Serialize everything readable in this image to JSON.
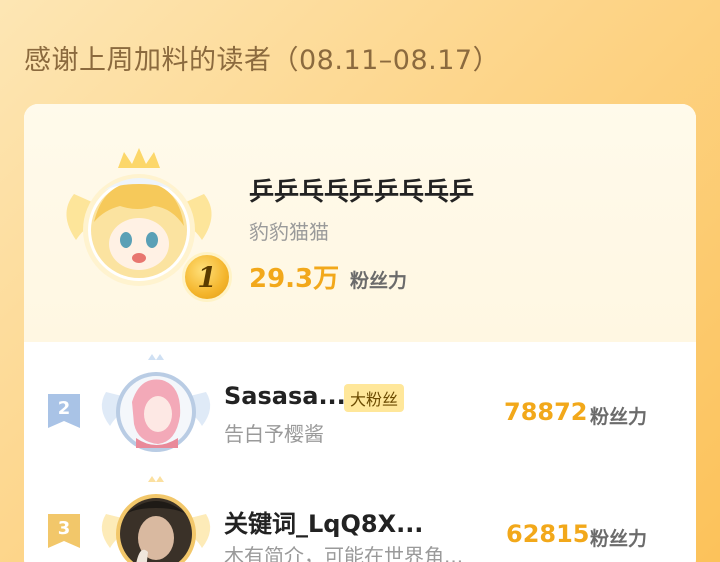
{
  "header": {
    "title": "感谢上周加料的读者（08.11–08.17）"
  },
  "top_reader": {
    "rank": "1",
    "name": "乒乒乓乓乒乒乓乓乒",
    "subtitle": "豹豹猫猫",
    "fan_count": "29.3万",
    "fan_unit": "粉丝力"
  },
  "readers": [
    {
      "rank": "2",
      "name": "Sasasa...",
      "tag": "大粉丝",
      "subtitle": "告白予樱酱",
      "fan_count": "78872",
      "fan_unit": "粉丝力"
    },
    {
      "rank": "3",
      "name": "关键词_LqQ8X...",
      "subtitle": "木有简介，可能在世界角...",
      "fan_count": "62815",
      "fan_unit": "粉丝力"
    }
  ],
  "colors": {
    "accent": "#f2a81a",
    "rank2": "#a9c3e6",
    "rank3": "#f2c76a"
  }
}
